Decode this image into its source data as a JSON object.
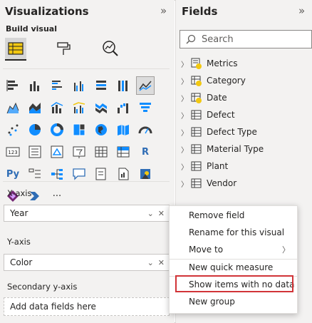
{
  "visualizations": {
    "title": "Visualizations",
    "collapse_icon": "chevron-double-right-icon",
    "build_visual_label": "Build visual",
    "gallery_extra_texts": {
      "r": "R",
      "py": "Py",
      "card": "123",
      "more": "···"
    }
  },
  "wells": {
    "xaxis": {
      "label": "X-axis",
      "field": "Year"
    },
    "yaxis": {
      "label": "Y-axis",
      "field": "Color"
    },
    "secondary": {
      "label": "Secondary y-axis",
      "placeholder": "Add data fields here"
    }
  },
  "fields": {
    "title": "Fields",
    "collapse_icon": "chevron-double-right-icon",
    "search_placeholder": "Search",
    "tables": [
      {
        "name": "Metrics"
      },
      {
        "name": "Category"
      },
      {
        "name": "Date"
      },
      {
        "name": "Defect"
      },
      {
        "name": "Defect Type"
      },
      {
        "name": "Material Type"
      },
      {
        "name": "Plant"
      },
      {
        "name": "Vendor"
      }
    ]
  },
  "context_menu": {
    "items": [
      "Remove field",
      "Rename for this visual",
      "Move to",
      "New quick measure",
      "Show items with no data",
      "New group"
    ],
    "highlighted": "Show items with no data"
  },
  "colors": {
    "accent_yellow": "#f2c811",
    "highlight_red": "#d13438",
    "panel_bg": "#f3f2f1"
  }
}
